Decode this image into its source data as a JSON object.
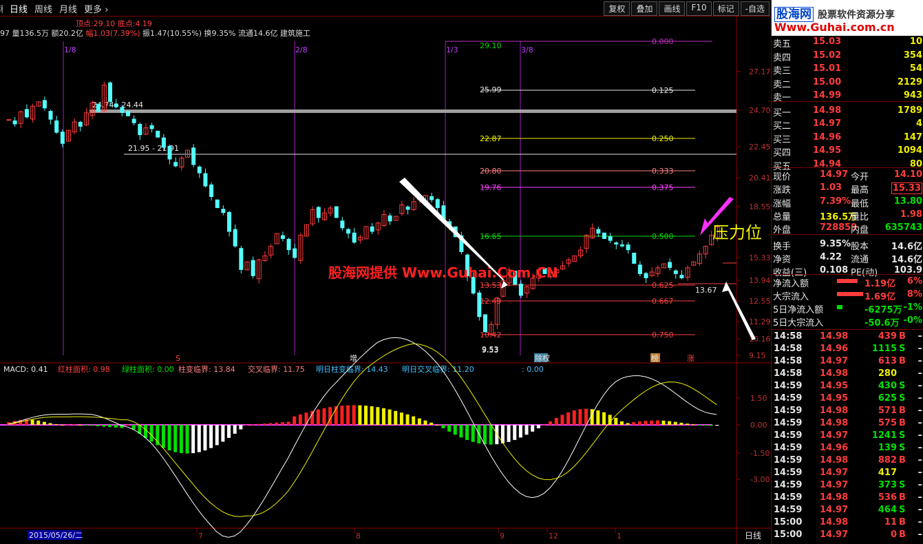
{
  "toolbar": {
    "tabs": [
      "日线",
      "周线",
      "月线",
      "更多"
    ],
    "prefix": "种",
    "buttons": [
      "复权",
      "叠加",
      "画线",
      "F10",
      "标记",
      "-自选"
    ]
  },
  "info": {
    "top_label": "顶点:",
    "top_value": "29.10",
    "bottom_label": "底点:",
    "bottom_value": "4.19",
    "line2_prefix": "97 量136.5万 额20.2亿",
    "line2_change": "幅1.03(7.39%)",
    "line2_rest": "振1.47(10.55%) 换9.35% 流通14.6亿 建筑施工"
  },
  "chart": {
    "y_ticks": [
      "27.17",
      "24.70",
      "22.45",
      "20.41",
      "18.55",
      "15.33",
      "13.94",
      "12.55",
      "11.29",
      "10.16",
      "9.15"
    ],
    "date_markers": [
      "1/8",
      "2/8",
      "1/3",
      "3/8"
    ],
    "fib_prices": [
      "29.10",
      "25.99",
      "22.87",
      "20.80",
      "19.76",
      "16.65",
      "13.53",
      "12.49",
      "10.42",
      "9.53"
    ],
    "fib_ratios": [
      "0.000",
      "0.125",
      "0.250",
      "0.333",
      "0.375",
      "0.500",
      "0.625",
      "0.667",
      "0.750"
    ],
    "label_range1": "24.74 - 24.44",
    "label_range2": "21.95 - 21.91",
    "label_low": "9.53",
    "label_last": "13.67",
    "watermark": "股海网提供 Www.Guhai.Com.CN",
    "pressure": "压力位",
    "event_tags": [
      "S",
      "增",
      "除权",
      "榜",
      "涨"
    ],
    "macd_line": "MACD: 0.41",
    "macd_red": "红柱面积: 0.98",
    "macd_green": "绿柱面积: 0.00",
    "macd_pillar": "柱变临界: 13.84",
    "macd_cross": "交叉临界: 11.75",
    "macd_next_pillar": "明日柱变临界: 14.43",
    "macd_next_cross": "明日交叉临界: 11.20",
    "macd_tail": ": 0.00",
    "macd_ticks": [
      "1.50",
      "0.00",
      "-1.50",
      "-3.00"
    ],
    "date_label": "2015/05/26/二",
    "x_ticks": [
      "7",
      "8",
      "9",
      "12",
      "1"
    ],
    "period": "日线"
  },
  "logo": {
    "brand": "股海网",
    "slogan": "股票软件资源分享",
    "url": "Www.Guhai.com.cn"
  },
  "orderbook": {
    "asks": [
      {
        "label": "卖五",
        "price": "15.03",
        "vol": "10"
      },
      {
        "label": "卖四",
        "price": "15.02",
        "vol": "354"
      },
      {
        "label": "卖三",
        "price": "15.01",
        "vol": "54"
      },
      {
        "label": "卖二",
        "price": "15.00",
        "vol": "2129"
      },
      {
        "label": "卖一",
        "price": "14.99",
        "vol": "943"
      }
    ],
    "bids": [
      {
        "label": "买一",
        "price": "14.98",
        "vol": "1789"
      },
      {
        "label": "买二",
        "price": "14.97",
        "vol": "4"
      },
      {
        "label": "买三",
        "price": "14.96",
        "vol": "147"
      },
      {
        "label": "买四",
        "price": "14.95",
        "vol": "1094"
      },
      {
        "label": "买五",
        "price": "14.94",
        "vol": "80"
      }
    ]
  },
  "quote": [
    {
      "l1": "现价",
      "v1": "14.97",
      "l2": "今开",
      "v2": "14.10",
      "c1": "red",
      "c2": "red"
    },
    {
      "l1": "涨跌",
      "v1": "1.03",
      "l2": "最高",
      "v2": "15.33",
      "c1": "red",
      "c2": "red"
    },
    {
      "l1": "涨幅",
      "v1": "7.39%",
      "l2": "最低",
      "v2": "13.80",
      "c1": "red",
      "c2": "grn"
    },
    {
      "l1": "总量",
      "v1": "136.5万",
      "l2": "量比",
      "v2": "1.98",
      "c1": "yel",
      "c2": "red"
    },
    {
      "l1": "外盘",
      "v1": "728859",
      "l2": "内盘",
      "v2": "635743",
      "c1": "red",
      "c2": "grn"
    },
    {
      "l1": "换手",
      "v1": "9.35%",
      "l2": "股本",
      "v2": "14.6亿",
      "c1": "wht",
      "c2": "wht"
    },
    {
      "l1": "净资",
      "v1": "4.22",
      "l2": "流通",
      "v2": "14.6亿",
      "c1": "wht",
      "c2": "wht"
    },
    {
      "l1": "收益(三)",
      "v1": "0.108",
      "l2": "PE(动)",
      "v2": "103.9",
      "c1": "wht",
      "c2": "wht"
    }
  ],
  "flows": [
    {
      "label": "净流入额",
      "value": "1.19亿",
      "pct": "6%",
      "color": "red",
      "bar": 30
    },
    {
      "label": "大宗流入",
      "value": "1.69亿",
      "pct": "8%",
      "color": "red",
      "bar": 38
    },
    {
      "label": "5日净流入额",
      "value": "-6275万",
      "pct": "-1%",
      "color": "grn",
      "bar": 8
    },
    {
      "label": "5日大宗流入",
      "value": "-50.6万",
      "pct": "-0%",
      "color": "grn",
      "bar": 0
    }
  ],
  "ticks": [
    {
      "t": "14:58",
      "p": "14.98",
      "v": "439",
      "s": "B"
    },
    {
      "t": "14:58",
      "p": "14.96",
      "v": "1115",
      "s": "S"
    },
    {
      "t": "14:58",
      "p": "14.97",
      "v": "613",
      "s": "B"
    },
    {
      "t": "14:58",
      "p": "14.98",
      "v": "280",
      "s": ""
    },
    {
      "t": "14:59",
      "p": "14.95",
      "v": "430",
      "s": "S"
    },
    {
      "t": "14:59",
      "p": "14.95",
      "v": "625",
      "s": "S"
    },
    {
      "t": "14:59",
      "p": "14.98",
      "v": "571",
      "s": "B"
    },
    {
      "t": "14:59",
      "p": "14.98",
      "v": "575",
      "s": "B"
    },
    {
      "t": "14:59",
      "p": "14.97",
      "v": "1241",
      "s": "S"
    },
    {
      "t": "14:59",
      "p": "14.96",
      "v": "139",
      "s": "S"
    },
    {
      "t": "14:59",
      "p": "14.98",
      "v": "882",
      "s": "B"
    },
    {
      "t": "14:59",
      "p": "14.97",
      "v": "417",
      "s": ""
    },
    {
      "t": "14:59",
      "p": "14.97",
      "v": "373",
      "s": "S"
    },
    {
      "t": "14:59",
      "p": "14.98",
      "v": "536",
      "s": "B"
    },
    {
      "t": "14:59",
      "p": "14.97",
      "v": "464",
      "s": "S"
    },
    {
      "t": "15:00",
      "p": "14.98",
      "v": "11",
      "s": "B"
    },
    {
      "t": "15:00",
      "p": "14.97",
      "v": "0",
      "s": "B"
    }
  ]
}
